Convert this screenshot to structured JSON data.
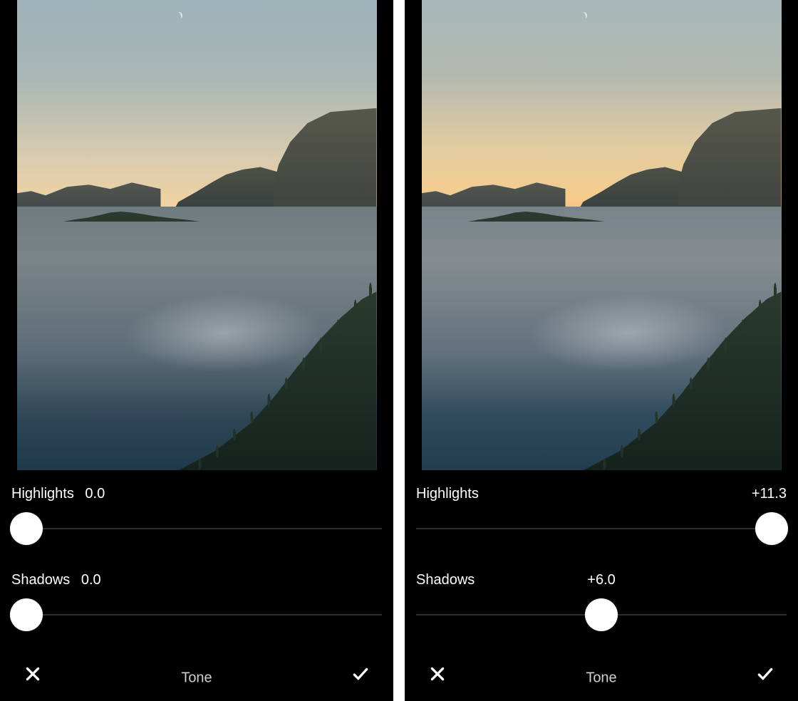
{
  "panels": [
    {
      "sliders": {
        "highlights": {
          "label": "Highlights",
          "value": "0.0",
          "position_pct": 4
        },
        "shadows": {
          "label": "Shadows",
          "value": "0.0",
          "position_pct": 4
        }
      },
      "tool_title": "Tone"
    },
    {
      "sliders": {
        "highlights": {
          "label": "Highlights",
          "value": "+11.3",
          "position_pct": 96
        },
        "shadows": {
          "label": "Shadows",
          "value": "+6.0",
          "position_pct": 50
        }
      },
      "tool_title": "Tone"
    }
  ],
  "icons": {
    "cancel": "close-icon",
    "confirm": "check-icon"
  }
}
